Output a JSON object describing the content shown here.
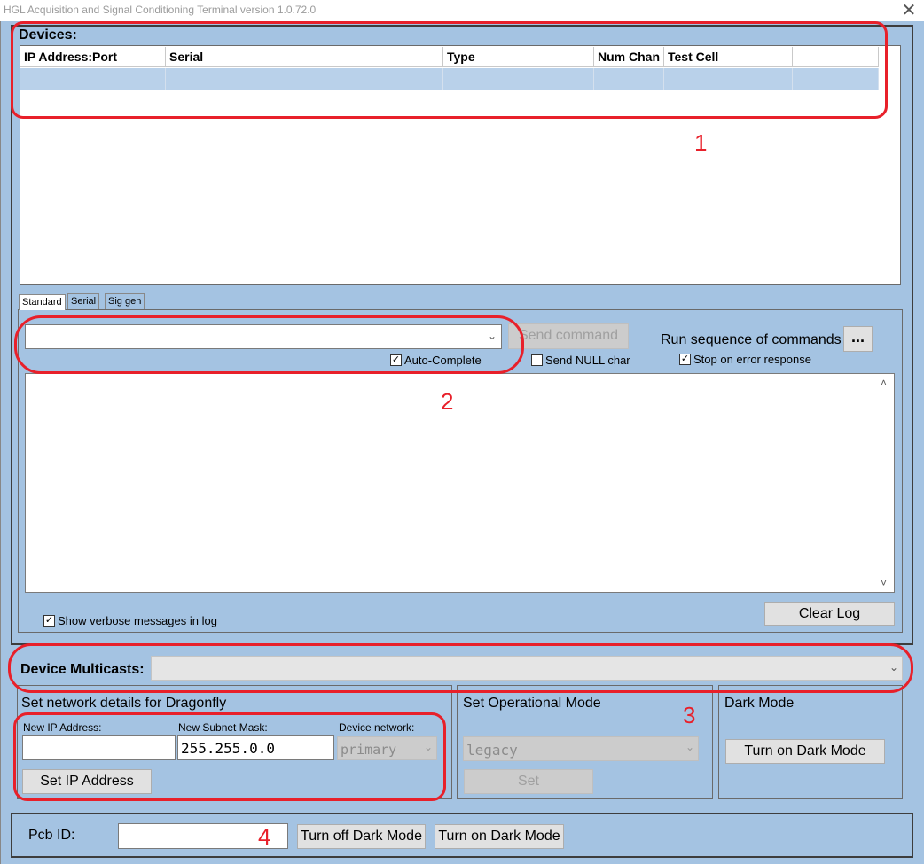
{
  "window": {
    "title": "HGL Acquisition and Signal Conditioning Terminal version 1.0.72.0",
    "close_glyph": "✕"
  },
  "devices": {
    "label": "Devices:",
    "columns": [
      "IP Address:Port",
      "Serial",
      "Type",
      "Num Chan",
      "Test Cell",
      ""
    ]
  },
  "tabs": [
    "Standard",
    "Serial",
    "Sig gen"
  ],
  "command": {
    "input_value": "",
    "send_label": "Send command",
    "auto_complete_label": "Auto-Complete",
    "auto_complete_checked": true,
    "send_null_label": "Send NULL char",
    "send_null_checked": false,
    "run_sequence_label": "Run sequence of commands",
    "browse_label": "...",
    "stop_on_error_label": "Stop on error response",
    "stop_on_error_checked": true
  },
  "log": {
    "verbose_label": "Show verbose messages in log",
    "verbose_checked": true,
    "clear_label": "Clear Log"
  },
  "multicast": {
    "label": "Device Multicasts:",
    "value": ""
  },
  "network": {
    "title": "Set network details for Dragonfly",
    "new_ip_label": "New IP Address:",
    "new_ip_value": "",
    "subnet_label": "New Subnet Mask:",
    "subnet_value": "255.255.0.0",
    "device_network_label": "Device network:",
    "device_network_value": "primary",
    "set_ip_label": "Set IP Address"
  },
  "op_mode": {
    "title": "Set Operational Mode",
    "value": "legacy",
    "set_label": "Set"
  },
  "dark_mode": {
    "title": "Dark Mode",
    "turn_on_label": "Turn on Dark Mode"
  },
  "bottom": {
    "pcb_label": "Pcb ID:",
    "pcb_value": "",
    "turn_off_label": "Turn off Dark Mode",
    "turn_on_label": "Turn on Dark Mode"
  },
  "annotations": [
    "1",
    "2",
    "3",
    "4"
  ],
  "colors": {
    "annotation_red": "#e8202a",
    "background_blue": "#a4c3e2",
    "selected_row": "#b9d1ea"
  },
  "icons": {
    "checkbox": "checkmark-icon",
    "dropdown": "chevron-down-icon",
    "scroll_up": "scroll-up-icon",
    "scroll_down": "scroll-down-icon"
  }
}
